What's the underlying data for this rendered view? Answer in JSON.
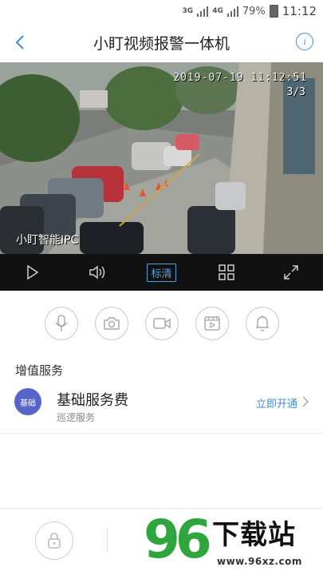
{
  "status_bar": {
    "network_1": "3G",
    "network_2": "4G",
    "battery": "79%",
    "time": "11:12"
  },
  "header": {
    "title": "小盯视频报警一体机",
    "back_icon": "chevron-left-icon",
    "info_icon": "info-icon",
    "info_glyph": "i"
  },
  "video": {
    "timestamp": "2019-07-19 11:12:51",
    "counter": "3/3",
    "camera_name": "小盯智能IPC"
  },
  "controls": {
    "play_icon": "play-icon",
    "volume_icon": "volume-icon",
    "quality_label": "标清",
    "grid_icon": "grid-icon",
    "fullscreen_icon": "fullscreen-icon"
  },
  "actions": [
    "microphone-icon",
    "camera-icon",
    "video-record-icon",
    "playback-icon",
    "alarm-bell-icon"
  ],
  "value_added": {
    "section_title": "增值服务",
    "service": {
      "badge": "基础",
      "name": "基础服务费",
      "subtitle": "巡逻服务",
      "action": "立即开通"
    }
  },
  "bottom": {
    "lock_icon": "lock-icon"
  },
  "watermark": {
    "number": "96",
    "text": "下载站",
    "url": "www.96xz.com"
  },
  "colors": {
    "accent": "#3b8fd9",
    "badge": "#5864c7",
    "control_bar": "#111111",
    "watermark_green": "#2fa53e"
  }
}
